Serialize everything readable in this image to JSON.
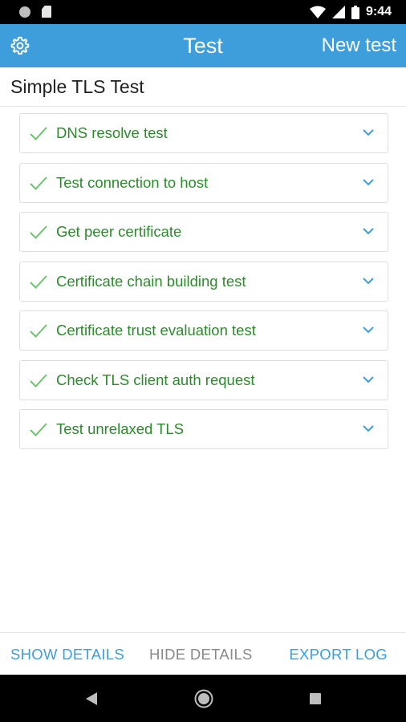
{
  "status_bar": {
    "time": "9:44",
    "icons": [
      "circle-notification-icon",
      "sd-card-icon",
      "wifi-icon",
      "cell-signal-icon",
      "battery-icon"
    ]
  },
  "app_bar": {
    "title": "Test",
    "settings_icon": "gear-icon",
    "action_label": "New test",
    "color": "#3d9edb"
  },
  "page": {
    "heading": "Simple TLS Test"
  },
  "tests": [
    {
      "label": "DNS resolve test",
      "status": "passed"
    },
    {
      "label": "Test connection to host",
      "status": "passed"
    },
    {
      "label": "Get peer certificate",
      "status": "passed"
    },
    {
      "label": "Certificate chain building test",
      "status": "passed"
    },
    {
      "label": "Certificate trust evaluation test",
      "status": "passed"
    },
    {
      "label": "Check TLS client auth request",
      "status": "passed"
    },
    {
      "label": "Test unrelaxed TLS",
      "status": "passed"
    }
  ],
  "colors": {
    "pass_text": "#2b8a2b",
    "pass_check": "#6cc36c",
    "chevron": "#3d9edb",
    "accent": "#3d9edb",
    "disabled": "#8a8a8a"
  },
  "actions": {
    "show_details": "SHOW DETAILS",
    "hide_details": "HIDE DETAILS",
    "export_log": "EXPORT LOG"
  },
  "nav_bar": {
    "icons": [
      "back-icon",
      "home-icon",
      "recents-icon"
    ]
  }
}
